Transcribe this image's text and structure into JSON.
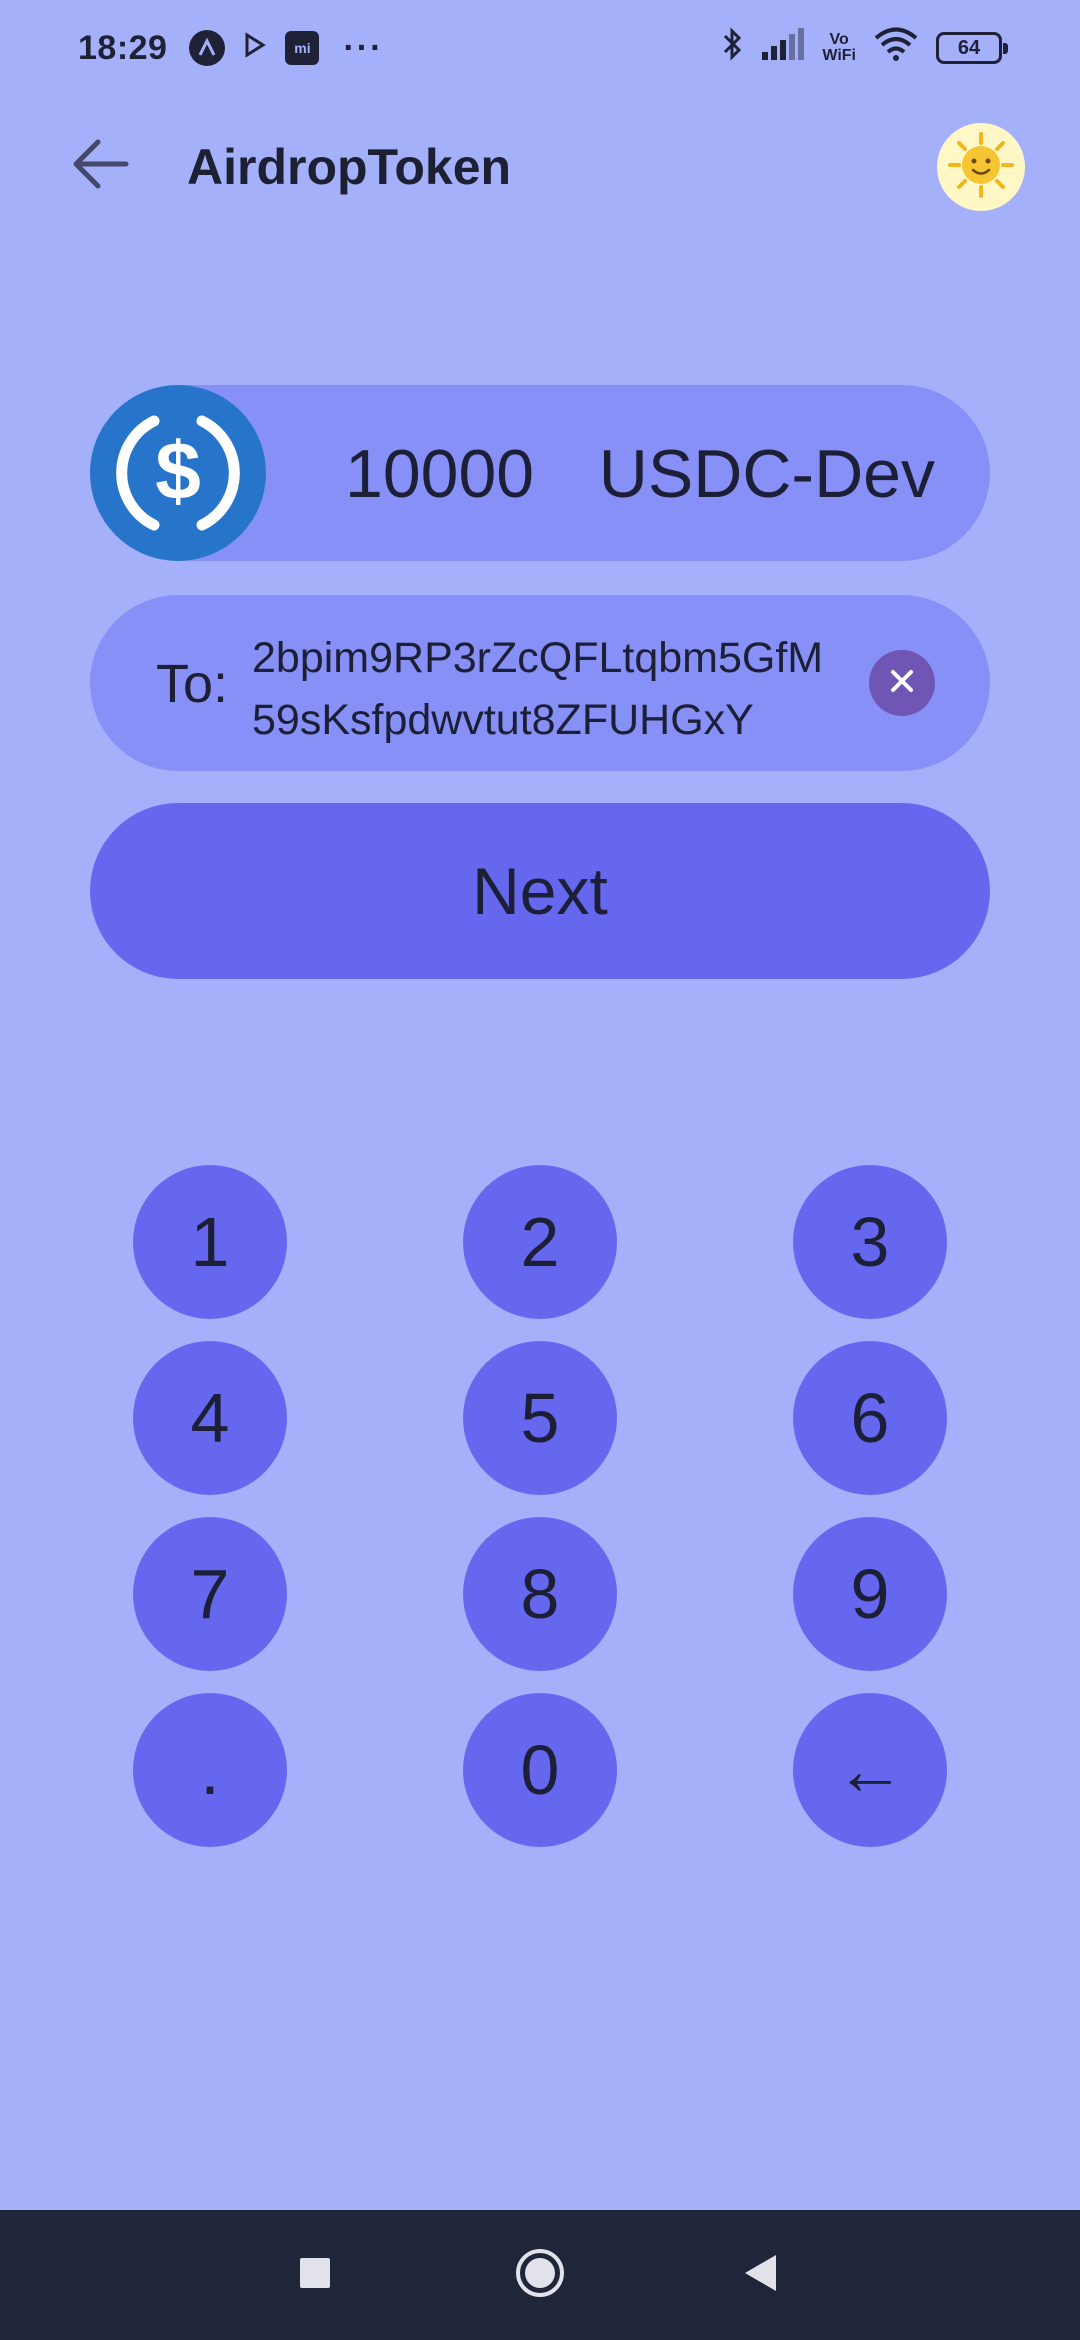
{
  "status_bar": {
    "time": "18:29",
    "notification_icons": [
      "a-badge-icon",
      "play-icon",
      "mi-store-icon"
    ],
    "mi_label": "mi",
    "more_label": "···",
    "vowifi_label_top": "Vo",
    "vowifi_label_bottom": "WiFi",
    "battery_level": "64"
  },
  "app_bar": {
    "title": "AirdropToken",
    "back_icon": "arrow-left-icon",
    "avatar_icon": "sun-face-icon"
  },
  "amount": {
    "value": "10000",
    "token_symbol": "USDC-Dev",
    "token_logo": "usdc-icon"
  },
  "recipient": {
    "label": "To:",
    "address_line1": "2bpim9RP3rZcQFLtqbm5GfM",
    "address_line2": "59sKsfpdwvtut8ZFUHGxY",
    "clear_icon": "close-icon"
  },
  "next_button": {
    "label": "Next"
  },
  "keypad": {
    "keys": [
      "1",
      "2",
      "3",
      "4",
      "5",
      "6",
      "7",
      "8",
      "9",
      ".",
      "0",
      "←"
    ]
  },
  "nav_bar": {
    "icons": [
      "recents-square-icon",
      "home-circle-icon",
      "back-triangle-icon"
    ]
  },
  "colors": {
    "background": "#a5b0fb",
    "pill": "#8690f7",
    "accent": "#6567ef",
    "clear_button": "#6f56b4",
    "usdc_blue": "#2775ca",
    "nav_bar": "#1f2639"
  }
}
